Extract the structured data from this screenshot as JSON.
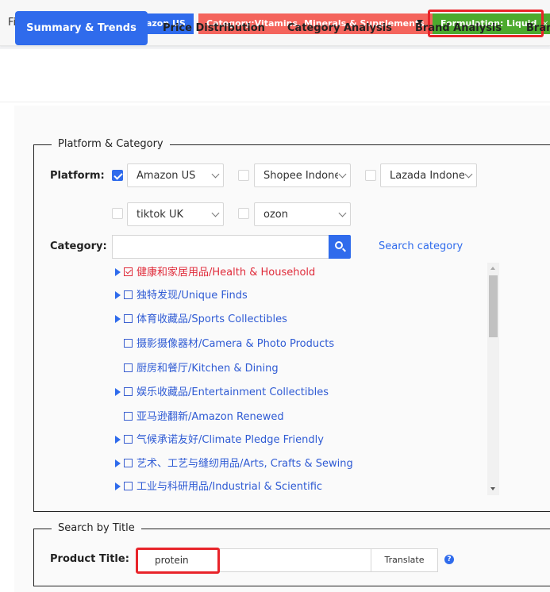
{
  "filter_bar": {
    "label": "Filter:",
    "chips": {
      "platform": "Platform: Amazon US",
      "category": "Category:Vitamins, Minerals & Supplements",
      "formulation": "Formulation: Liquid",
      "formulation_close": "×"
    }
  },
  "tabs": {
    "summary": "Summary & Trends",
    "price": "Price Distribution",
    "category": "Category Analysis",
    "brand": "Brand Analysis",
    "more": "Bran"
  },
  "platform_category": {
    "legend": "Platform & Category",
    "platform_label": "Platform:",
    "platforms": [
      {
        "name": "Amazon US",
        "checked": true
      },
      {
        "name": "Shopee Indone",
        "checked": false
      },
      {
        "name": "Lazada Indone",
        "checked": false
      },
      {
        "name": "tiktok UK",
        "checked": false
      },
      {
        "name": "ozon",
        "checked": false
      }
    ],
    "category_label": "Category:",
    "category_value": "",
    "search_category": "Search category",
    "tree": [
      {
        "text": "☑ 健康和家居用品/Health & Household",
        "label": "健康和家居用品/Health & Household",
        "expandable": true,
        "selected": true
      },
      {
        "label": "独特发现/Unique Finds",
        "expandable": true,
        "selected": false
      },
      {
        "label": "体育收藏品/Sports Collectibles",
        "expandable": true,
        "selected": false
      },
      {
        "label": "摄影摄像器材/Camera & Photo Products",
        "expandable": false,
        "selected": false
      },
      {
        "label": "厨房和餐厅/Kitchen & Dining",
        "expandable": false,
        "selected": false
      },
      {
        "label": "娱乐收藏品/Entertainment Collectibles",
        "expandable": true,
        "selected": false
      },
      {
        "label": "亚马逊翻新/Amazon Renewed",
        "expandable": false,
        "selected": false
      },
      {
        "label": "气候承诺友好/Climate Pledge Friendly",
        "expandable": true,
        "selected": false
      },
      {
        "label": "艺术、工艺与缝纫用品/Arts, Crafts & Sewing",
        "expandable": true,
        "selected": false
      },
      {
        "label": "工业与科研用品/Industrial & Scientific",
        "expandable": true,
        "selected": false
      }
    ]
  },
  "search_by_title": {
    "legend": "Search by Title",
    "label": "Product Title:",
    "value": "protein",
    "translate": "Translate",
    "help": "?"
  },
  "colors": {
    "accent": "#2f6bec",
    "category_chip": "#f4645c",
    "formulation_chip": "#4caa2e",
    "highlight": "#e8242a",
    "selected_tree": "#e02b3a"
  }
}
